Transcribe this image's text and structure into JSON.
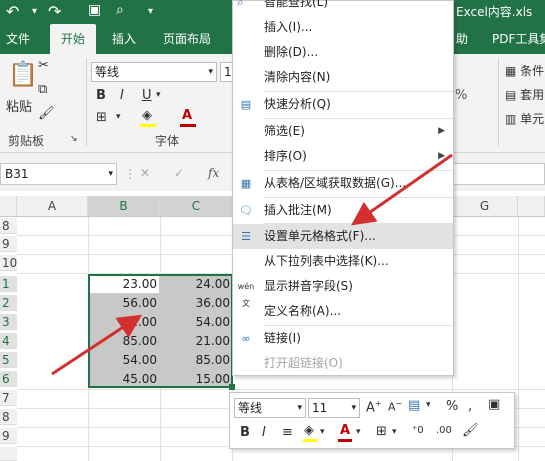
{
  "titlebar": {
    "filename": "Excel内容.xls",
    "menu_partial": "智能查找(L)"
  },
  "tabs": [
    "文件",
    "开始",
    "插入",
    "页面布局",
    "助",
    "PDF工具集"
  ],
  "ribbon": {
    "paste_label": "粘贴",
    "clipboard_label": "剪贴板",
    "font_name": "等线",
    "font_size": "1",
    "font_group_label": "字体",
    "percent": "%",
    "cond_format": "条件",
    "table_format": "套用",
    "cell_styles": "单元"
  },
  "formula_bar": {
    "name_box": "B31",
    "fx": "fx"
  },
  "columns": [
    "A",
    "B",
    "C",
    "G"
  ],
  "rows": [
    "8",
    "9",
    "10",
    "1",
    "2",
    "3",
    "4",
    "5",
    "6",
    "7",
    "8",
    "9"
  ],
  "cells_b": [
    "23.00",
    "56.00",
    "62.00",
    "85.00",
    "54.00",
    "45.00"
  ],
  "cells_c": [
    "24.00",
    "36.00",
    "54.00",
    "21.00",
    "85.00",
    "15.00"
  ],
  "context_menu": {
    "items": [
      {
        "label": "插入(I)...",
        "icon": "",
        "submenu": false
      },
      {
        "label": "删除(D)...",
        "icon": "",
        "submenu": false
      },
      {
        "label": "清除内容(N)",
        "icon": "",
        "submenu": false
      },
      {
        "label": "快速分析(Q)",
        "icon": "quick-analysis-icon",
        "submenu": false
      },
      {
        "label": "筛选(E)",
        "icon": "",
        "submenu": true
      },
      {
        "label": "排序(O)",
        "icon": "",
        "submenu": true
      },
      {
        "label": "从表格/区域获取数据(G)...",
        "icon": "table-icon",
        "submenu": false
      },
      {
        "label": "插入批注(M)",
        "icon": "comment-icon",
        "submenu": false
      },
      {
        "label": "设置单元格格式(F)...",
        "icon": "format-cells-icon",
        "submenu": false
      },
      {
        "label": "从下拉列表中选择(K)...",
        "icon": "",
        "submenu": false
      },
      {
        "label": "显示拼音字段(S)",
        "icon": "phonetic-icon",
        "submenu": false
      },
      {
        "label": "定义名称(A)...",
        "icon": "",
        "submenu": false
      },
      {
        "label": "链接(I)",
        "icon": "link-icon",
        "submenu": false
      },
      {
        "label": "打开超链接(O)",
        "icon": "",
        "submenu": false
      }
    ]
  },
  "mini_toolbar": {
    "font_name": "等线",
    "font_size": "11",
    "percent": "%",
    "bold": "B",
    "italic": "I"
  },
  "colors": {
    "excel_green": "#217346",
    "arrow_red": "#d32f2f",
    "highlight": "#e2e2e2",
    "selection_fill": "#c8c8c8"
  }
}
